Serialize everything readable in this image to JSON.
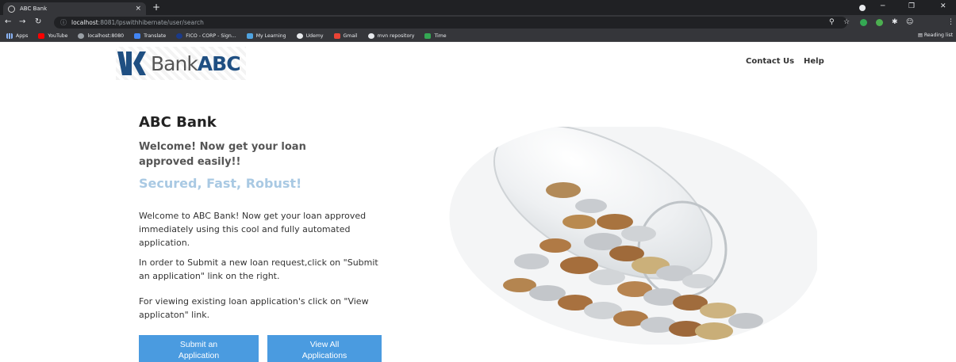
{
  "browser": {
    "tab_title": "ABC Bank",
    "tab_close": "×",
    "new_tab": "+",
    "url_host": "localhost",
    "url_path": ":8081/lpswithhibernate/user/search",
    "bookmarks": [
      {
        "label": "Apps",
        "color": "#5f6368"
      },
      {
        "label": "YouTube",
        "color": "#ff0000"
      },
      {
        "label": "localhost:8080",
        "color": "#9aa0a6"
      },
      {
        "label": "Translate",
        "color": "#4285f4"
      },
      {
        "label": "FICO - CORP - Sign...",
        "color": "#1a3a8a"
      },
      {
        "label": "My Learning",
        "color": "#4fa3e0"
      },
      {
        "label": "Udemy",
        "color": "#e8eaed"
      },
      {
        "label": "Gmail",
        "color": "#ea4335"
      },
      {
        "label": "mvn repository",
        "color": "#e8eaed"
      },
      {
        "label": "Time",
        "color": "#34a853"
      }
    ],
    "reading_list": "Reading list"
  },
  "header": {
    "logo_bank": "Bank",
    "logo_abc": "ABC",
    "nav": [
      "Contact Us",
      "Help"
    ]
  },
  "main": {
    "title": "ABC Bank",
    "welcome": "Welcome! Now get your loan approved easily!!",
    "tagline": "Secured, Fast, Robust!",
    "paragraphs": [
      "Welcome to ABC Bank! Now get your loan approved immediately using this cool and fully automated application.",
      "In order to Submit a new loan request,click on \"Submit an application\" link on the right.",
      "For viewing existing loan application's click on \"View applicaton\" link."
    ],
    "buttons": {
      "submit_line1": "Submit an",
      "submit_line2": "Application",
      "view_line1": "View All",
      "view_line2": "Applications"
    }
  },
  "colors": {
    "button_bg": "#4a9be0",
    "tagline": "#a9c9e3",
    "logo_blue": "#1f4f82"
  }
}
